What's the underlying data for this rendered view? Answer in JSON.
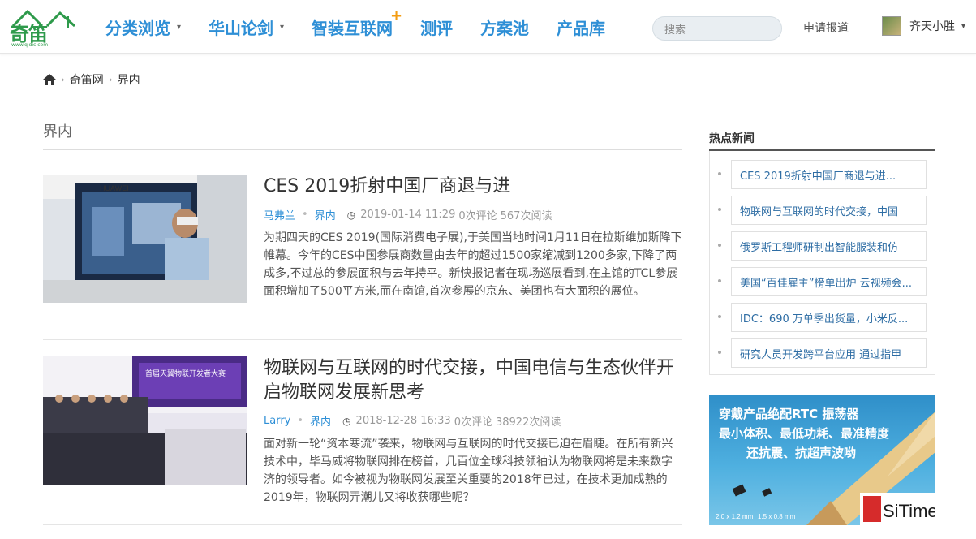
{
  "header": {
    "logo_text": "奇笛",
    "logo_url_text": "www.qidic.com",
    "nav": [
      {
        "label": "分类浏览",
        "caret": "▾"
      },
      {
        "label": "华山论剑",
        "caret": "▾"
      },
      {
        "label": "智装互联网",
        "badge": "+"
      },
      {
        "label": "测评"
      },
      {
        "label": "方案池"
      },
      {
        "label": "产品库"
      }
    ],
    "search_placeholder": "搜索",
    "apply_label": "申请报道",
    "user_name": "齐天小胜",
    "user_caret": "▾"
  },
  "breadcrumb": {
    "home_icon": "home-icon",
    "items": [
      "奇笛网",
      "界内"
    ],
    "separator": "›"
  },
  "main": {
    "section_title": "界内",
    "articles": [
      {
        "title": "CES 2019折射中国厂商退与进",
        "author": "马弗兰",
        "category": "界内",
        "datetime": "2019-01-14 11:29",
        "comments": "0次评论",
        "reads": "567次阅读",
        "summary": "为期四天的CES 2019(国际消费电子展),于美国当地时间1月11日在拉斯维加斯降下帷幕。今年的CES中国参展商数量由去年的超过1500家缩减到1200多家,下降了两成多,不过总的参展面积与去年持平。新快报记者在现场巡展看到,在主馆的TCL参展面积增加了500平方米,而在南馆,首次参展的京东、美团也有大面积的展位。",
        "thumb_caption": "HUAWEI"
      },
      {
        "title": "物联网与互联网的时代交接，中国电信与生态伙伴开启物联网发展新思考",
        "author": "Larry",
        "category": "界内",
        "datetime": "2018-12-28 16:33",
        "comments": "0次评论",
        "reads": "38922次阅读",
        "summary": "面对新一轮“资本寒流”袭来，物联网与互联网的时代交接已迫在眉睫。在所有新兴技术中，毕马威将物联网排在榜首，几百位全球科技领袖认为物联网将是未来数字济的领导者。如今被视为物联网发展至关重要的2018年已过，在技术更加成熟的2019年，物联网弄潮儿又将收获哪些呢？",
        "thumb_caption": "首届天翼物联开发者大赛"
      }
    ]
  },
  "sidebar": {
    "title": "热点新闻",
    "items": [
      "CES 2019折射中国厂商退与进...",
      "物联网与互联网的时代交接，中国",
      "俄罗斯工程师研制出智能服装和仿",
      "美国“百佳雇主”榜单出炉 云视频会...",
      "IDC：690 万单季出货量，小米反...",
      "研究人员开发跨平台应用 通过指甲"
    ],
    "ad": {
      "lines": [
        "穿戴产品绝配RTC 振荡器",
        "最小体积、最低功耗、最准精度",
        "还抗震、抗超声波哟"
      ],
      "size_labels": [
        "2.0 x 1.2 mm",
        "1.5 x 0.8 mm"
      ],
      "brand": "SiTime"
    }
  }
}
